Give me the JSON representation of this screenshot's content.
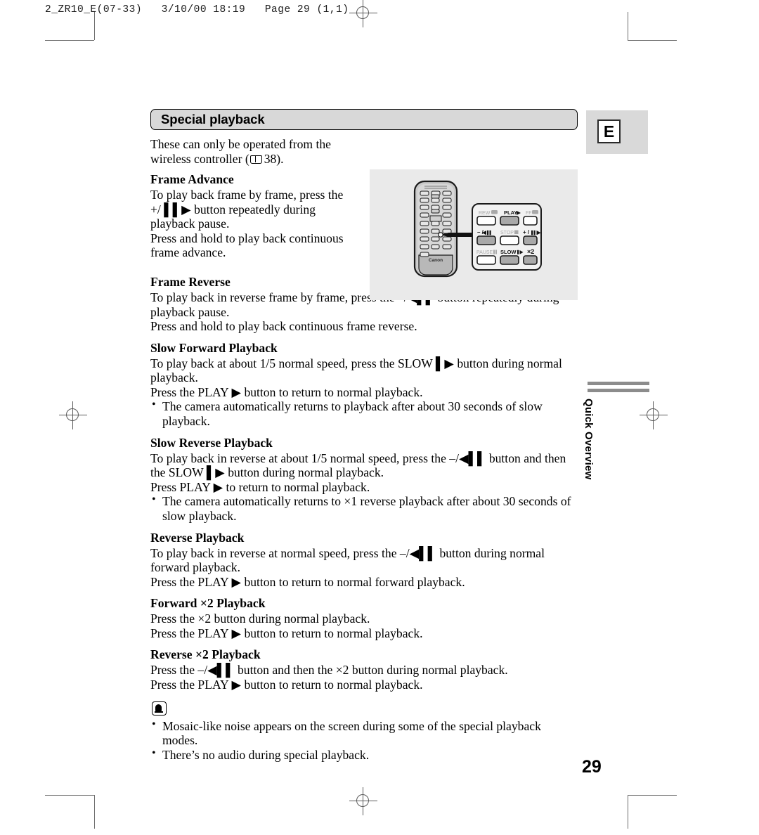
{
  "print_header": "2_ZR10_E(07-33)   3/10/00 18:19   Page 29 (1,1)",
  "section": {
    "title": "Special playback"
  },
  "intro": {
    "line1": "These can only be operated from the",
    "line2_pre": "wireless controller (",
    "line2_page_ref": "38",
    "line2_post": ")."
  },
  "sections": [
    {
      "heading": "Frame Advance",
      "lines": [
        "To play back frame by frame, press the",
        "+/ ▌▌▶ button repeatedly during",
        "playback pause.",
        "Press and hold to play back continuous",
        "frame advance."
      ]
    },
    {
      "heading": "Frame Reverse",
      "lines": [
        "To play back in reverse frame by frame, press the –/◀▌▌ button repeatedly during playback pause.",
        "Press and hold to play back continuous frame reverse."
      ]
    },
    {
      "heading": "Slow Forward Playback",
      "lines": [
        "To play back at about 1/5 normal speed, press the SLOW ▌▶ button during normal playback.",
        "Press the PLAY ▶ button to return to normal playback."
      ],
      "bullets": [
        "The camera automatically returns to playback after about 30 seconds of slow playback."
      ]
    },
    {
      "heading": "Slow Reverse Playback",
      "lines": [
        "To play back in reverse at about 1/5 normal speed, press the –/◀▌▌ button and then the SLOW ▌▶ button during normal playback.",
        "Press PLAY ▶ to return to normal playback."
      ],
      "bullets": [
        "The camera automatically returns to ×1 reverse playback after about 30 seconds of slow playback."
      ]
    },
    {
      "heading": "Reverse Playback",
      "lines": [
        "To play back in reverse at normal speed, press the –/◀▌▌ button during normal forward playback.",
        "Press the PLAY ▶ button to return to normal forward playback."
      ]
    },
    {
      "heading": "Forward ×2 Playback",
      "lines": [
        "Press the ×2 button during normal playback.",
        "Press the PLAY ▶ button to return to normal playback."
      ]
    },
    {
      "heading": "Reverse ×2 Playback",
      "lines": [
        "Press the –/◀▌▌ button and then the ×2 button during normal playback.",
        "Press the PLAY ▶ button to return to normal playback."
      ]
    }
  ],
  "notes": [
    "Mosaic-like noise appears on the screen during some of the special playback modes.",
    "There’s no audio during special playback."
  ],
  "figure": {
    "brand": "Canon",
    "callout_buttons": [
      {
        "label": "REW",
        "glyph": "◀◀",
        "highlighted": false
      },
      {
        "label": "PLAY",
        "glyph": "▶",
        "highlighted": true
      },
      {
        "label": "FF",
        "glyph": "▶▶",
        "highlighted": false
      },
      {
        "label": "– /",
        "glyph": "◀▌▌",
        "highlighted": true
      },
      {
        "label": "STOP",
        "glyph": "■",
        "highlighted": false
      },
      {
        "label": "+ /",
        "glyph": "▌▌▶",
        "highlighted": true
      },
      {
        "label": "PAUSE",
        "glyph": "▌▌",
        "highlighted": false
      },
      {
        "label": "SLOW",
        "glyph": "▌▶",
        "highlighted": true
      },
      {
        "label": "×2",
        "glyph": "",
        "highlighted": true
      }
    ]
  },
  "margin": {
    "language_tab": "E",
    "chapter_tab": "Quick Overview"
  },
  "page_number": "29"
}
